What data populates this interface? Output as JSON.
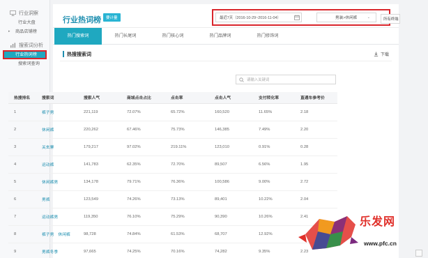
{
  "sidebar": {
    "industry_section": "行业洞察",
    "industry_items": [
      "行业大盘",
      "商品店铺榜"
    ],
    "search_section": "搜索词分析",
    "search_items": [
      "行业热词榜",
      "搜索词查询"
    ]
  },
  "header": {
    "title": "行业热词榜",
    "badge": "要计量",
    "date_range": "最近7天（2016-10-29~2016-11-04）",
    "category": "男装>休闲裤",
    "terminal": "所有终端"
  },
  "tabs": [
    "热门搜索词",
    "热门长尾词",
    "热门核心词",
    "热门品牌词",
    "热门修饰词"
  ],
  "section": {
    "title": "热搜搜索词",
    "download": "下载"
  },
  "search": {
    "placeholder": "请输入关键词"
  },
  "table": {
    "columns": [
      "热搜排名",
      "搜索词",
      "搜索人气",
      "商城点击占比",
      "点击率",
      "点击人气",
      "支付转化率",
      "直通车参考价"
    ],
    "rows": [
      {
        "rank": "1",
        "keyword": [
          "裤子男"
        ],
        "popularity": "221,119",
        "mall_click": "72.07%",
        "ctr": "65.72%",
        "click_pop": "160,520",
        "cvr": "11.65%",
        "ppc": "2.18"
      },
      {
        "rank": "2",
        "keyword": [
          "休闲裤"
        ],
        "popularity": "220,262",
        "mall_click": "67.46%",
        "ctr": "75.73%",
        "click_pop": "146,385",
        "cvr": "7.49%",
        "ppc": "2.20"
      },
      {
        "rank": "3",
        "keyword": [
          "关玄寨"
        ],
        "popularity": "179,217",
        "mall_click": "97.02%",
        "ctr": "219.11%",
        "click_pop": "123,010",
        "cvr": "0.91%",
        "ppc": "0.28"
      },
      {
        "rank": "4",
        "keyword": [
          "运动裤"
        ],
        "popularity": "141,783",
        "mall_click": "62.35%",
        "ctr": "72.70%",
        "click_pop": "89,507",
        "cvr": "6.56%",
        "ppc": "1.95"
      },
      {
        "rank": "5",
        "keyword": [
          "休闲裤男"
        ],
        "popularity": "134,178",
        "mall_click": "79.71%",
        "ctr": "76.36%",
        "click_pop": "100,586",
        "cvr": "9.00%",
        "ppc": "2.72"
      },
      {
        "rank": "6",
        "keyword": [
          "男裤"
        ],
        "popularity": "123,549",
        "mall_click": "74.26%",
        "ctr": "73.13%",
        "click_pop": "89,401",
        "cvr": "10.22%",
        "ppc": "2.04"
      },
      {
        "rank": "7",
        "keyword": [
          "运动裤男"
        ],
        "popularity": "119,350",
        "mall_click": "76.10%",
        "ctr": "75.29%",
        "click_pop": "90,390",
        "cvr": "10.26%",
        "ppc": "2.41"
      },
      {
        "rank": "8",
        "keyword": [
          "裤子男",
          "休闲裤"
        ],
        "popularity": "98,728",
        "mall_click": "74.84%",
        "ctr": "61.53%",
        "click_pop": "68,707",
        "cvr": "12.92%",
        "ppc": ""
      },
      {
        "rank": "9",
        "keyword": [
          "男裤冬季"
        ],
        "popularity": "97,665",
        "mall_click": "74.25%",
        "ctr": "70.16%",
        "click_pop": "74,282",
        "cvr": "9.35%",
        "ppc": "2.23"
      }
    ]
  },
  "watermark": {
    "brand": "乐发网",
    "url": "www.pfc.cn"
  },
  "colors": {
    "accent": "#1fa8c0",
    "title": "#1f8fb0",
    "highlight": "#d9262c"
  }
}
